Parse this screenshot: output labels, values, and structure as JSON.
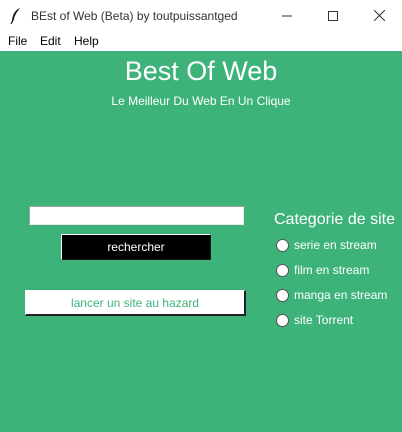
{
  "window": {
    "title": "BEst of Web (Beta) by toutpuissantged",
    "app_icon": "feather-icon",
    "controls": {
      "minimize": "minimize-icon",
      "maximize": "maximize-icon",
      "close": "close-icon"
    }
  },
  "menu": {
    "items": [
      {
        "label": "File"
      },
      {
        "label": "Edit"
      },
      {
        "label": "Help"
      }
    ]
  },
  "main": {
    "title": "Best Of Web",
    "subtitle": "Le Meilleur Du Web En Un Clique",
    "search": {
      "value": "",
      "placeholder": ""
    },
    "search_button_label": "rechercher",
    "random_button_label": "lancer un site au hazard"
  },
  "categories": {
    "heading": "Categorie de site",
    "options": [
      {
        "label": "serie en stream",
        "selected": false
      },
      {
        "label": "film en stream",
        "selected": false
      },
      {
        "label": "manga en stream",
        "selected": false
      },
      {
        "label": "site Torrent",
        "selected": false
      }
    ]
  },
  "colors": {
    "background": "#3db37a",
    "search_button": "#000000",
    "random_button_text": "#3db37a"
  }
}
